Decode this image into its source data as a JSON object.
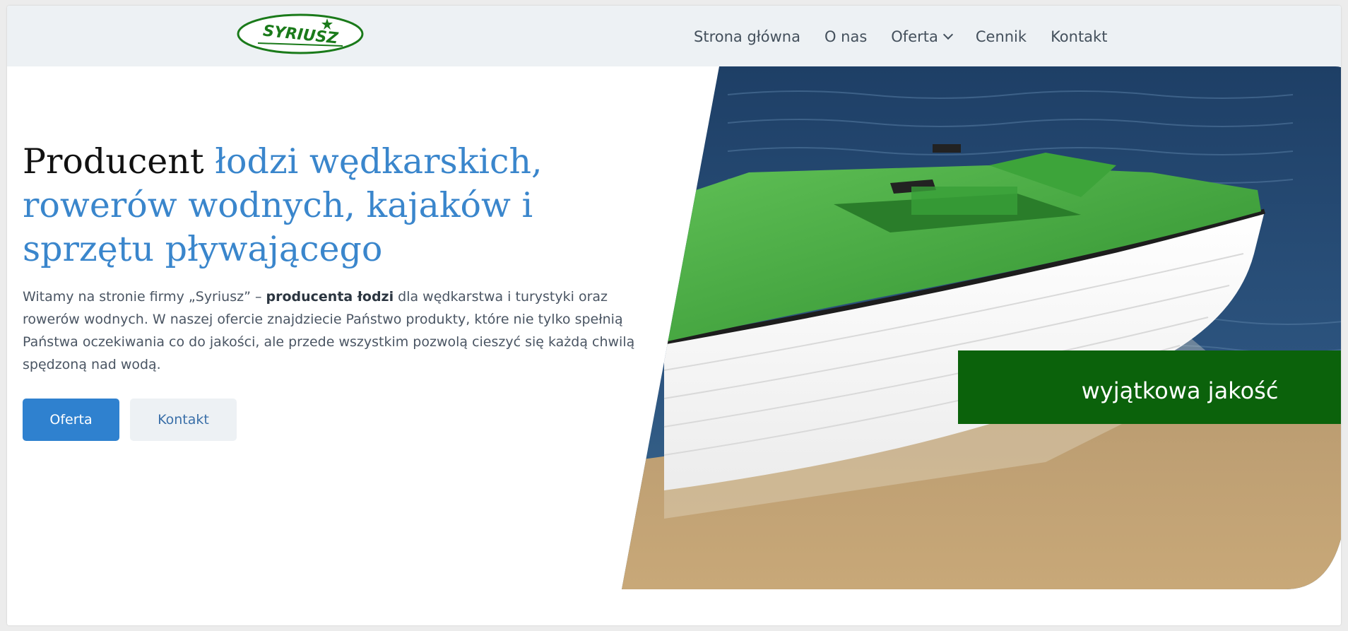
{
  "header": {
    "logo_text": "SYRIUSZ",
    "nav": [
      {
        "label": "Strona główna"
      },
      {
        "label": "O nas"
      },
      {
        "label": "Oferta",
        "has_dropdown": true
      },
      {
        "label": "Cennik"
      },
      {
        "label": "Kontakt"
      }
    ]
  },
  "hero": {
    "heading_dark": "Producent",
    "heading_accent": "łodzi wędkarskich, rowerów wodnych, kajaków i sprzętu pływającego",
    "intro_before": "Witamy na stronie firmy „Syriusz” – ",
    "intro_bold": "producenta łodzi",
    "intro_after": " dla wędkarstwa i turystyki oraz rowerów wodnych. W naszej ofercie znajdziecie Państwo produkty, które nie tylko spełnią Państwa oczekiwania co do jakości, ale przede wszystkim pozwolą cieszyć się każdą chwilą spędzoną nad wodą.",
    "primary_button": "Oferta",
    "secondary_button": "Kontakt",
    "image_badge": "wyjątkowa jakość"
  },
  "colors": {
    "header_bg": "#edf1f4",
    "accent_blue": "#3a86cc",
    "primary_button": "#2f81cf",
    "logo_green": "#1a7a1a",
    "badge_green": "#0b620b"
  }
}
